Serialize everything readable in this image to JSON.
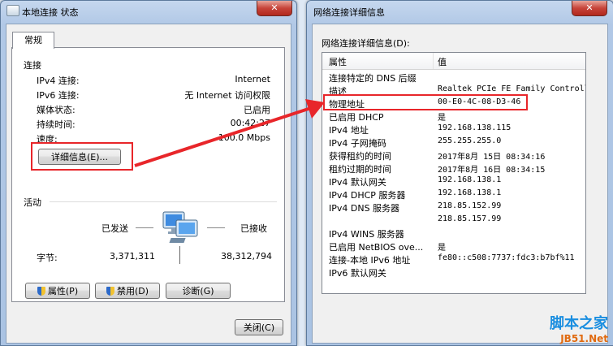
{
  "left_window": {
    "title": "本地连接 状态",
    "close_label": "✕",
    "tab": "常规",
    "section_connection": "连接",
    "fields": [
      {
        "label": "IPv4 连接:",
        "value": "Internet"
      },
      {
        "label": "IPv6 连接:",
        "value": "无 Internet 访问权限"
      },
      {
        "label": "媒体状态:",
        "value": "已启用"
      },
      {
        "label": "持续时间:",
        "value": "00:42:27"
      },
      {
        "label": "速度:",
        "value": "100.0 Mbps"
      }
    ],
    "details_button": "详细信息(E)...",
    "section_activity": "活动",
    "sent_label": "已发送",
    "received_label": "已接收",
    "bytes_label": "字节:",
    "bytes_sent": "3,371,311",
    "bytes_received": "38,312,794",
    "properties_button": "属性(P)",
    "disable_button": "禁用(D)",
    "diagnose_button": "诊断(G)",
    "close_button": "关闭(C)"
  },
  "right_window": {
    "title": "网络连接详细信息",
    "close_label": "✕",
    "list_caption": "网络连接详细信息(D):",
    "col_property": "属性",
    "col_value": "值",
    "rows": [
      {
        "p": "连接特定的 DNS 后缀",
        "v": ""
      },
      {
        "p": "描述",
        "v": "Realtek PCIe FE Family Controller"
      },
      {
        "p": "物理地址",
        "v": "00-E0-4C-08-D3-46"
      },
      {
        "p": "已启用 DHCP",
        "v": "是"
      },
      {
        "p": "IPv4 地址",
        "v": "192.168.138.115"
      },
      {
        "p": "IPv4 子网掩码",
        "v": "255.255.255.0"
      },
      {
        "p": "获得租约的时间",
        "v": "2017年8月 15日 08:34:16"
      },
      {
        "p": "租约过期的时间",
        "v": "2017年8月 16日 08:34:15"
      },
      {
        "p": "IPv4 默认网关",
        "v": "192.168.138.1"
      },
      {
        "p": "IPv4 DHCP 服务器",
        "v": "192.168.138.1"
      },
      {
        "p": "IPv4 DNS 服务器",
        "v": "218.85.152.99"
      },
      {
        "p": "",
        "v": "218.85.157.99"
      },
      {
        "p": "IPv4 WINS 服务器",
        "v": ""
      },
      {
        "p": "已启用 NetBIOS ove...",
        "v": "是"
      },
      {
        "p": "连接-本地 IPv6 地址",
        "v": "fe80::c508:7737:fdc3:b7bf%11"
      },
      {
        "p": "IPv6 默认网关",
        "v": ""
      }
    ]
  },
  "watermark": {
    "line1": "脚本之家",
    "line2": "JB51.Net"
  },
  "colors": {
    "highlight": "#e8262a",
    "title_bar": "#b1c8e6",
    "close": "#c7443a"
  },
  "icons": [
    "network-computers-icon",
    "shield-icon",
    "arrow-icon"
  ]
}
